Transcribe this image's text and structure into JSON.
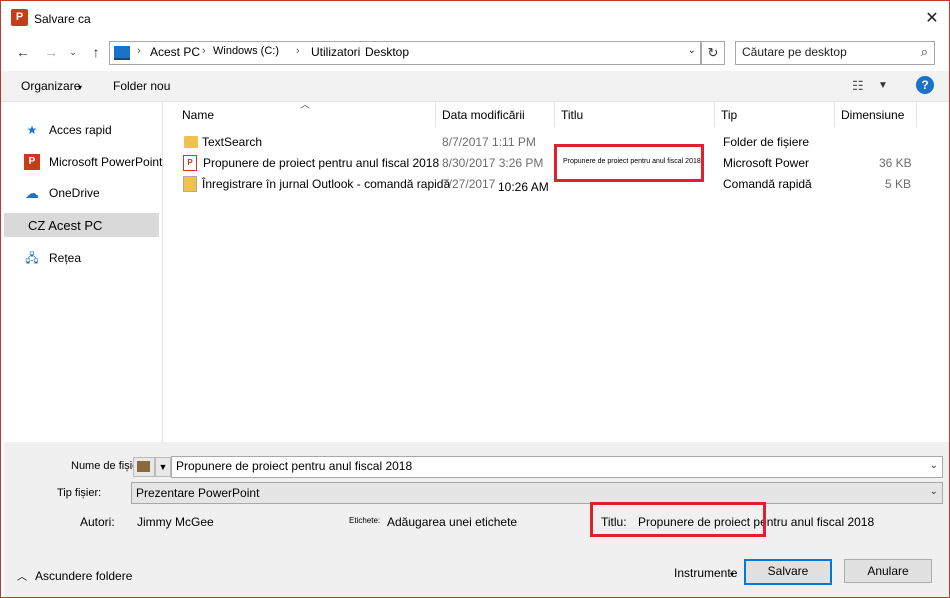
{
  "window": {
    "title": "Salvare ca",
    "app_icon": "P",
    "close": "✕"
  },
  "address": {
    "segments": [
      "Acest PC",
      "Windows (C:)",
      "Utilizatori",
      "Desktop"
    ],
    "sep": "›"
  },
  "search": {
    "placeholder": "Căutare pe desktop"
  },
  "toolbar": {
    "organize": "Organizare",
    "new_folder": "Folder nou",
    "help": "?"
  },
  "nav": {
    "items": [
      {
        "label": "Acces rapid",
        "icon": "★"
      },
      {
        "label": "Microsoft PowerPoint",
        "icon": "P"
      },
      {
        "label": "OneDrive",
        "icon": "☁"
      },
      {
        "label": "CZ Acest PC",
        "icon": ""
      },
      {
        "label": "Rețea",
        "icon": "🖧"
      }
    ]
  },
  "columns": {
    "name": "Name",
    "date": "Data modificării",
    "title": "Titlu",
    "type": "Tip",
    "size": "Dimensiune"
  },
  "rows": [
    {
      "name": "TextSearch",
      "date": "8/7/2017 1:11 PM",
      "title": "",
      "type": "Folder de fișiere",
      "size": ""
    },
    {
      "name": "Propunere de proiect pentru anul fiscal 2018",
      "date": "8/30/2017 3:26 PM",
      "title": "Propunere de proiect pentru anul fiscal 2018",
      "type": "Microsoft Power",
      "size": "36 KB"
    },
    {
      "name": "Înregistrare în jurnal Outlook - comandă rapidă",
      "date": "7/27/2017",
      "date_time": "10:26 AM",
      "title": "",
      "type": "Comandă rapidă",
      "size": "5 KB"
    }
  ],
  "form": {
    "filename_label": "Nume de fișier:",
    "filename_value": "Propunere de proiect pentru anul fiscal 2018",
    "filetype_label": "Tip fișier:",
    "filetype_value": "Prezentare PowerPoint",
    "authors_label": "Autori:",
    "authors_value": "Jimmy McGee",
    "tags_label": "Etichete:",
    "tags_value": "Adăugarea unei etichete",
    "title_label": "Titlu:",
    "title_value": "Propunere de proiect pentru anul fiscal 2018"
  },
  "footer": {
    "hide_folders": "Ascundere foldere",
    "tools": "Instrumente",
    "save": "Salvare",
    "cancel": "Anulare"
  },
  "colors": {
    "accent": "#0078d7",
    "highlight_box": "#e0202a",
    "ppt": "#c43e1c"
  }
}
